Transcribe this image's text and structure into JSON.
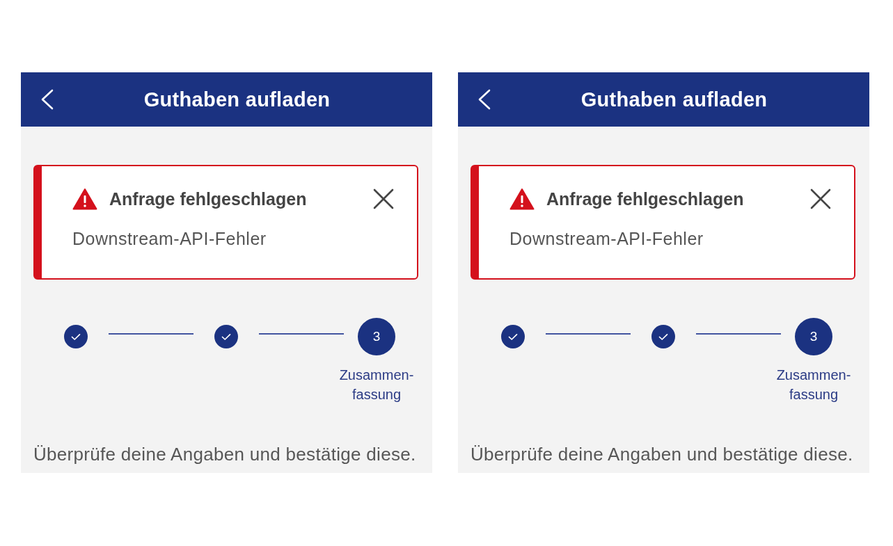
{
  "screens": [
    {
      "header": {
        "title": "Guthaben aufladen"
      },
      "alert": {
        "title": "Anfrage fehlgeschlagen",
        "message": "Downstream-API-Fehler"
      },
      "stepper": {
        "steps": [
          {
            "kind": "done"
          },
          {
            "kind": "done"
          },
          {
            "kind": "current",
            "number": "3",
            "label": "Zusammen-fassung"
          }
        ]
      },
      "instruction": "Überprüfe deine Angaben und bestätige diese."
    },
    {
      "header": {
        "title": "Guthaben aufladen"
      },
      "alert": {
        "title": "Anfrage fehlgeschlagen",
        "message": "Downstream-API-Fehler"
      },
      "stepper": {
        "steps": [
          {
            "kind": "done"
          },
          {
            "kind": "done"
          },
          {
            "kind": "current",
            "number": "3",
            "label": "Zusammen-fassung"
          }
        ]
      },
      "instruction": "Überprüfe deine Angaben und bestätige diese."
    }
  ]
}
